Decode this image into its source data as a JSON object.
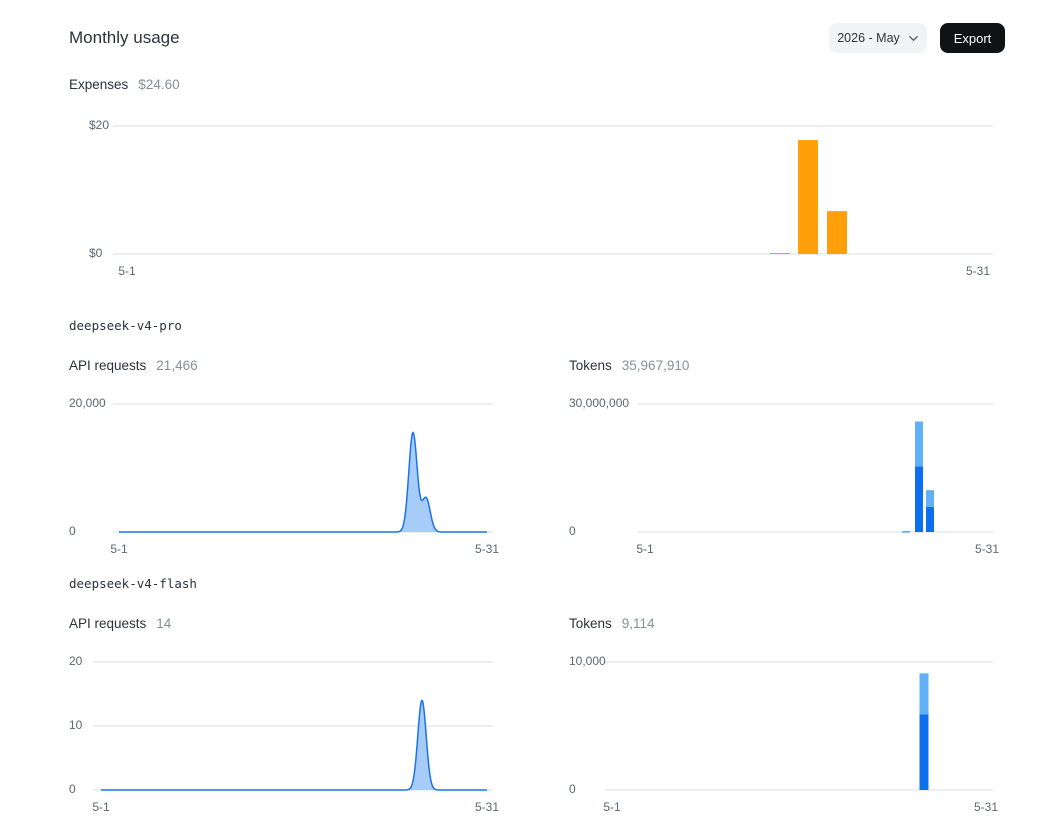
{
  "header": {
    "title": "Monthly usage",
    "period": "2026 - May",
    "export_label": "Export",
    "chevron_icon": "chevron-down-icon"
  },
  "expenses": {
    "label": "Expenses",
    "value": "$24.60"
  },
  "models": [
    {
      "name": "deepseek-v4-pro",
      "requests_label": "API requests",
      "requests_value": "21,466",
      "tokens_label": "Tokens",
      "tokens_value": "35,967,910"
    },
    {
      "name": "deepseek-v4-flash",
      "requests_label": "API requests",
      "requests_value": "14",
      "tokens_label": "Tokens",
      "tokens_value": "9,114"
    }
  ],
  "colors": {
    "expense_bar": "#ffa00a",
    "request_line": "#1a73e8",
    "request_fill": "#a7ccf7",
    "token_primary": "#0b6fef",
    "token_secondary": "#62b0f7",
    "grid": "#d9dce1"
  },
  "chart_data": [
    {
      "id": "expenses",
      "type": "bar",
      "x_start": "5-1",
      "x_end": "5-31",
      "days": 31,
      "ylim": [
        0,
        20
      ],
      "yticks": [
        0,
        20
      ],
      "ytick_labels": [
        "$0",
        "$20"
      ],
      "grid": true,
      "series": [
        {
          "values": {
            "24": 0.1,
            "25": 17.8,
            "26": 6.7
          }
        }
      ]
    },
    {
      "id": "pro-requests",
      "type": "area",
      "x_start": "5-1",
      "x_end": "5-31",
      "days": 31,
      "ylim": [
        0,
        20000
      ],
      "yticks": [
        0,
        20000
      ],
      "ytick_labels": [
        "0",
        "20,000"
      ],
      "grid": true,
      "series": [
        {
          "values": {
            "24": 15500,
            "25": 5300
          }
        }
      ]
    },
    {
      "id": "pro-tokens",
      "type": "bar",
      "stacked": true,
      "x_start": "5-1",
      "x_end": "5-31",
      "days": 31,
      "ylim": [
        0,
        30000000
      ],
      "yticks": [
        0,
        30000000
      ],
      "ytick_labels": [
        "0",
        "30,000,000"
      ],
      "grid": true,
      "series": [
        {
          "values": {
            "23": 150000,
            "24": 15400000,
            "25": 5900000
          }
        },
        {
          "values": {
            "23": 100000,
            "24": 10500000,
            "25": 3900000
          }
        }
      ]
    },
    {
      "id": "flash-requests",
      "type": "area",
      "x_start": "5-1",
      "x_end": "5-31",
      "days": 31,
      "ylim": [
        0,
        20
      ],
      "yticks": [
        0,
        10,
        20
      ],
      "ytick_labels": [
        "0",
        "10",
        "20"
      ],
      "grid": true,
      "series": [
        {
          "values": {
            "25": 14
          }
        }
      ]
    },
    {
      "id": "flash-tokens",
      "type": "bar",
      "stacked": true,
      "x_start": "5-1",
      "x_end": "5-31",
      "days": 31,
      "ylim": [
        0,
        10000
      ],
      "yticks": [
        0,
        10000
      ],
      "ytick_labels": [
        "0",
        "10,000"
      ],
      "grid": true,
      "series": [
        {
          "values": {
            "25": 5900
          }
        },
        {
          "values": {
            "25": 3214
          }
        }
      ]
    }
  ]
}
